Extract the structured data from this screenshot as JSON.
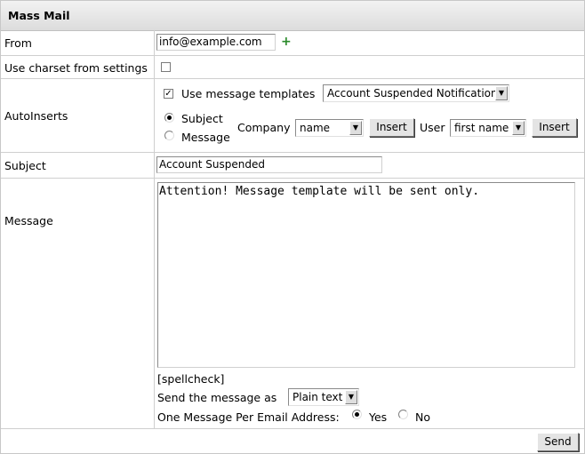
{
  "window": {
    "title": "Mass Mail"
  },
  "from": {
    "label": "From",
    "value": "info@example.com",
    "add_icon": "+"
  },
  "charset": {
    "label": "Use charset from settings",
    "checked": false
  },
  "autoinserts": {
    "label": "AutoInserts",
    "use_templates_label": "Use message templates",
    "use_templates_checked": true,
    "template_selected": "Account Suspended Notification",
    "target_subject_label": "Subject",
    "target_message_label": "Message",
    "company_label": "Company",
    "company_selected": "name",
    "insert_label": "Insert",
    "user_label": "User",
    "user_selected": "first name"
  },
  "subject": {
    "label": "Subject",
    "value": "Account Suspended"
  },
  "message": {
    "label": "Message",
    "value": "Attention! Message template will be sent only.",
    "spellcheck": "[spellcheck]",
    "send_as_label": "Send the message as",
    "send_as_selected": "Plain text",
    "one_per_email_label": "One Message Per Email Address:",
    "yes_label": "Yes",
    "no_label": "No"
  },
  "footer": {
    "send_label": "Send"
  },
  "colors": {
    "plus_icon": "#2a8a2a"
  }
}
